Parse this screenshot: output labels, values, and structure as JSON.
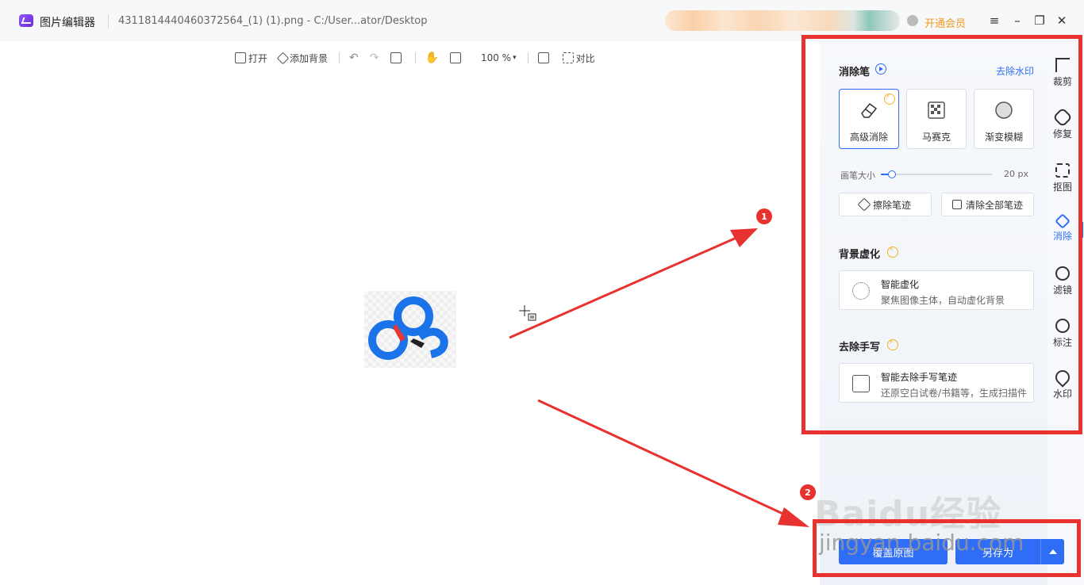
{
  "window": {
    "app_title": "图片编辑器",
    "file_path": "4311814440460372564_(1) (1).png - C:/User...ator/Desktop",
    "vip_label": "开通会员"
  },
  "toolbar": {
    "open": "打开",
    "add_background": "添加背景",
    "zoom": "100 %",
    "compare": "对比"
  },
  "panel": {
    "eraser_section": {
      "title": "消除笔",
      "remove_watermark_link": "去除水印",
      "modes": [
        "高级消除",
        "马赛克",
        "渐变模糊"
      ],
      "selected_mode": "高级消除",
      "brush_size_label": "画笔大小",
      "brush_size_value": "20 px",
      "brush_size_fraction": 0.1,
      "erase_strokes": "擦除笔迹",
      "clear_all_strokes": "清除全部笔迹"
    },
    "blur_section": {
      "title": "背景虚化",
      "card_title": "智能虚化",
      "card_desc": "聚焦图像主体，自动虚化背景"
    },
    "handwriting_section": {
      "title": "去除手写",
      "card_title": "智能去除手写笔迹",
      "card_desc": "还原空白试卷/书籍等，生成扫描件"
    }
  },
  "sidenav": {
    "items": [
      "裁剪",
      "修复",
      "抠图",
      "消除",
      "滤镜",
      "标注",
      "水印"
    ],
    "active": "消除"
  },
  "actions": {
    "overwrite": "覆盖原图",
    "save_as": "另存为"
  },
  "annotations": {
    "badge1": "1",
    "badge2": "2"
  },
  "watermark": {
    "big": "Baidu经验",
    "small": "jingyan.baidu.com"
  },
  "colors": {
    "accent": "#2f6df6",
    "annotation_red": "#e8322f",
    "vip_orange": "#f29a1f",
    "lightning_gold": "#f0b429"
  }
}
